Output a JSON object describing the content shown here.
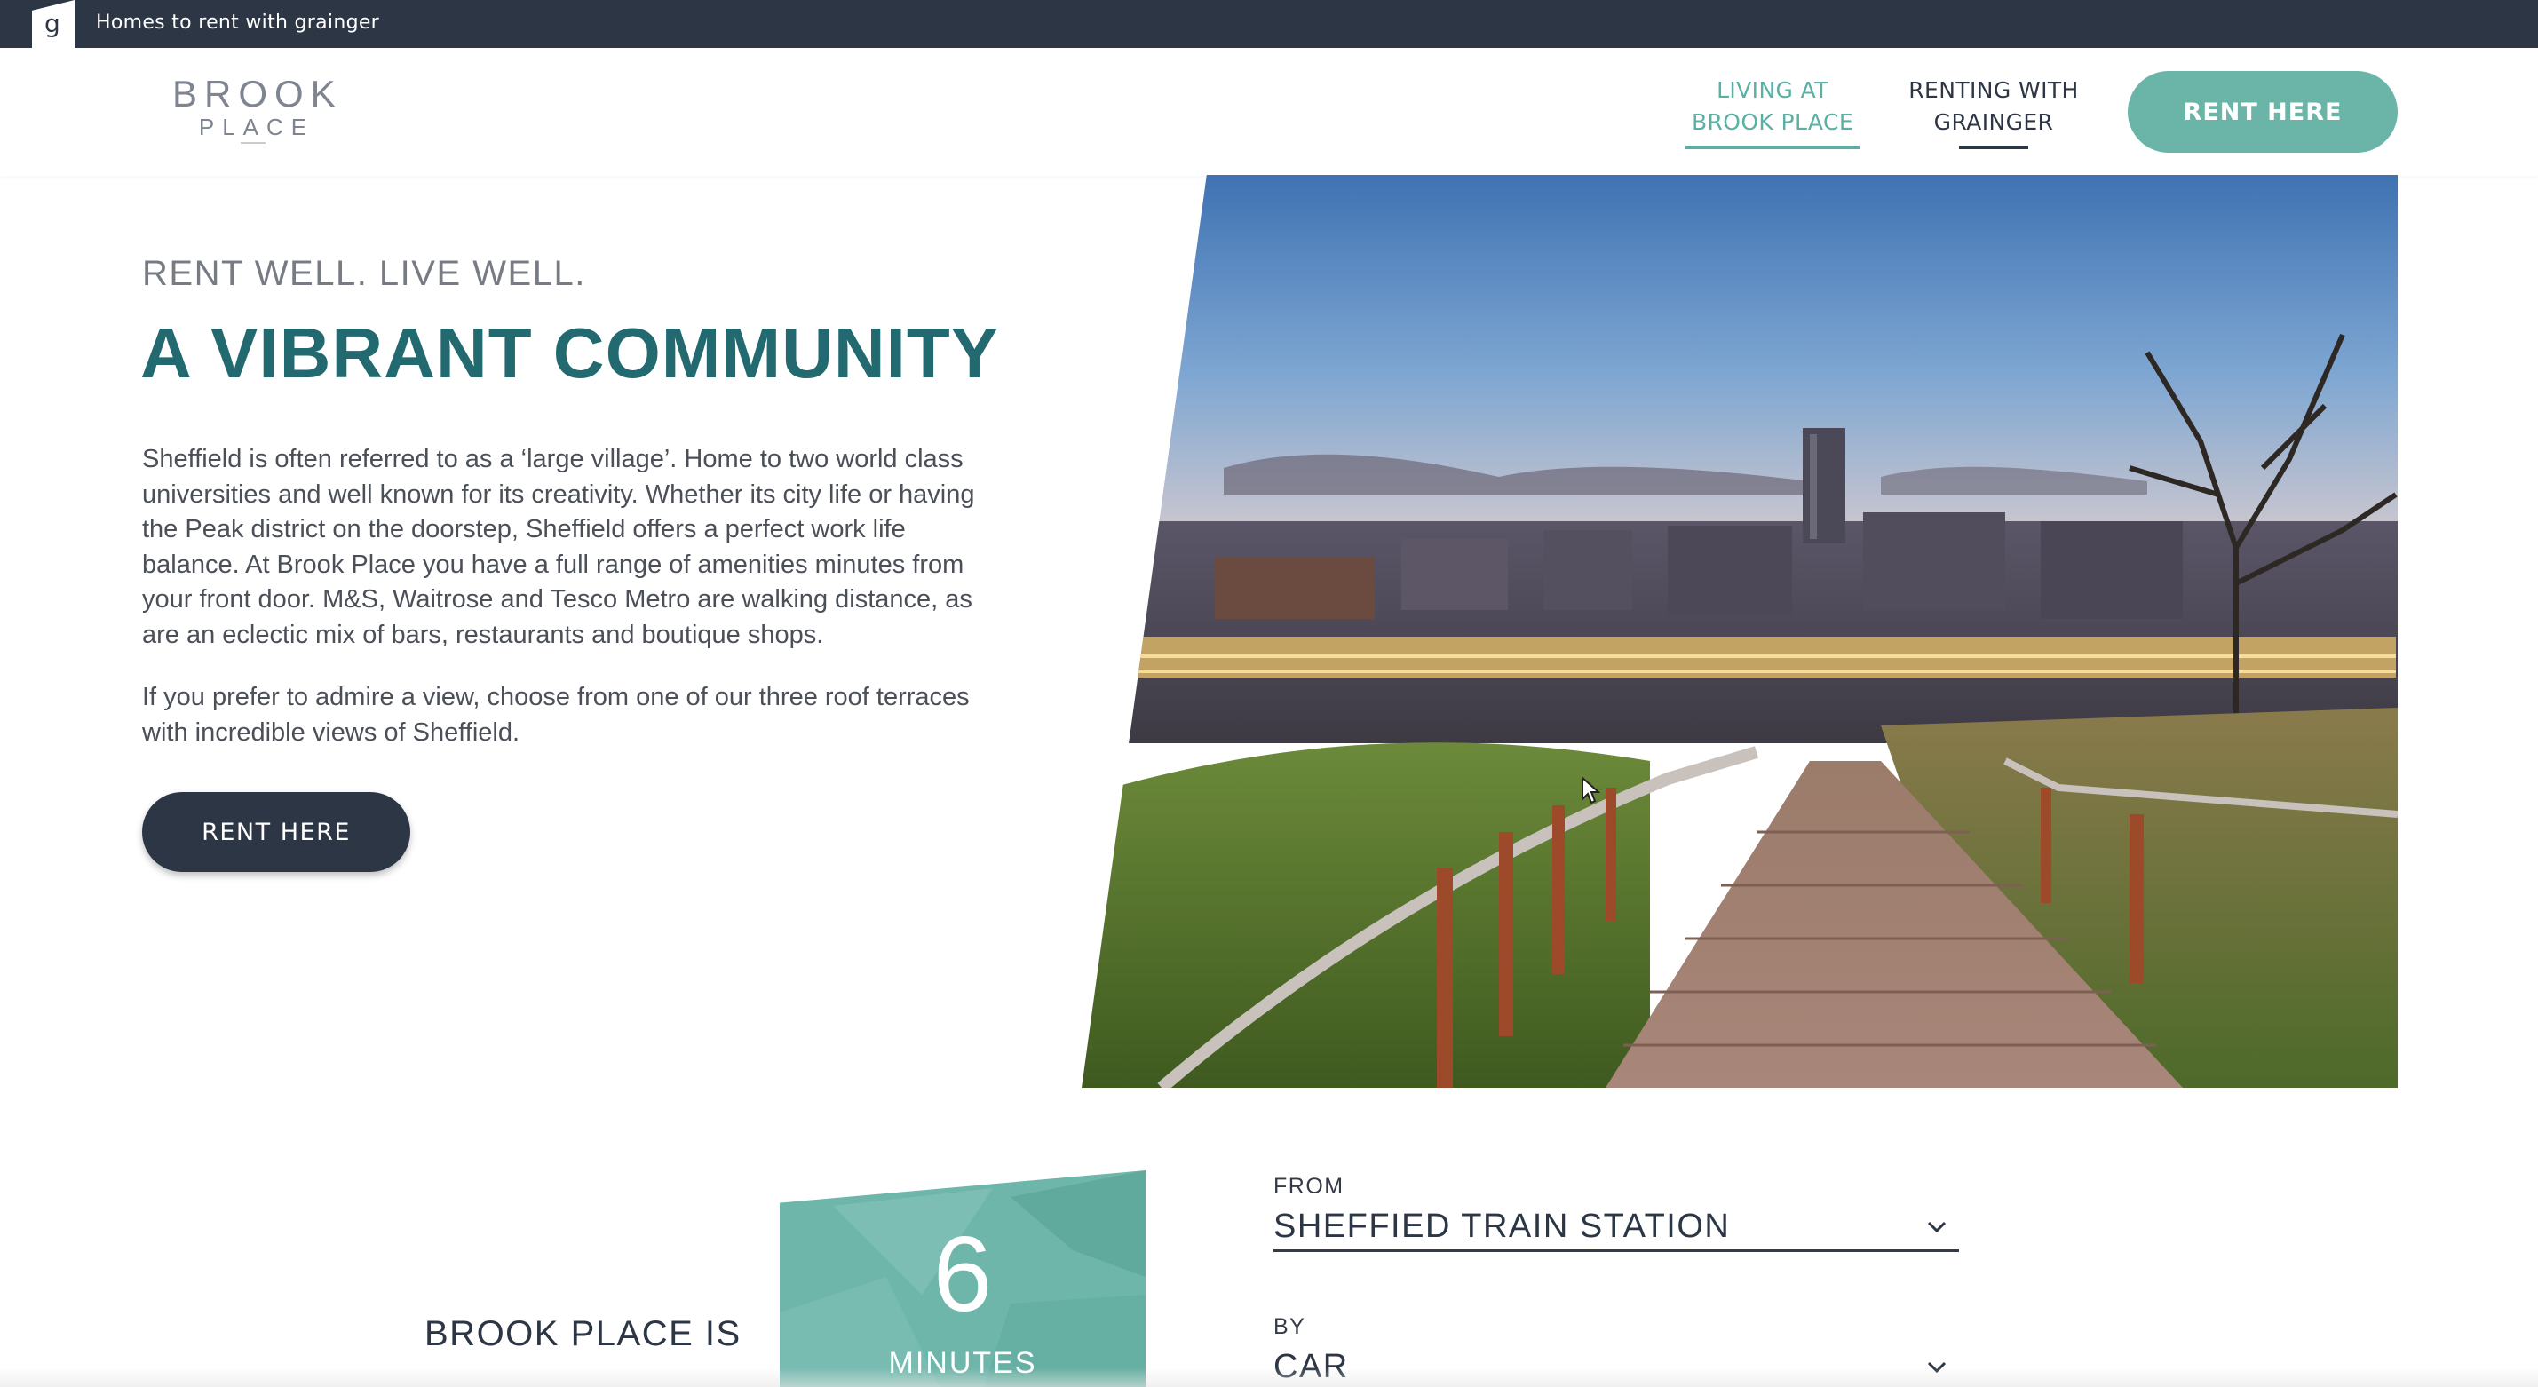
{
  "topbar": {
    "text": "Homes to rent with grainger",
    "logo_letter": "g"
  },
  "brand": {
    "top": "BROOK",
    "bottom": "PLACE"
  },
  "nav": [
    {
      "label_line1": "LIVING AT",
      "label_line2": "BROOK PLACE",
      "active": true
    },
    {
      "label_line1": "RENTING WITH",
      "label_line2": "GRAINGER",
      "active": false
    }
  ],
  "header_cta": "RENT HERE",
  "hero": {
    "eyebrow": "RENT WELL. LIVE WELL.",
    "headline": "A VIBRANT COMMUNITY",
    "para1_lines": [
      "Sheffield is often referred to as a ‘large village’. Home to two world class",
      "universities and well known for its creativity.  Whether its city life or having",
      "the Peak district on the doorstep, Sheffield offers a perfect work life",
      "balance. At Brook Place you have a full range of amenities minutes from",
      "your front door.  M&S, Waitrose and Tesco Metro are walking distance, as",
      "are an eclectic mix of bars, restaurants and boutique shops."
    ],
    "para2_lines": [
      "If you prefer to admire a view, choose from one of our three roof terraces",
      "with incredible views of Sheffield."
    ],
    "cta": "RENT HERE"
  },
  "travel": {
    "prefix": "BROOK PLACE IS",
    "minutes_value": "6",
    "minutes_label": "MINUTES",
    "from_label": "FROM",
    "from_value": "SHEFFIED TRAIN STATION",
    "by_label": "BY",
    "by_value": "CAR"
  },
  "colors": {
    "dark_navy": "#2c3644",
    "teal": "#6ab5a8",
    "headline_teal": "#226a70"
  },
  "icons": [
    "chevron-down-icon",
    "mouse-cursor-icon"
  ]
}
